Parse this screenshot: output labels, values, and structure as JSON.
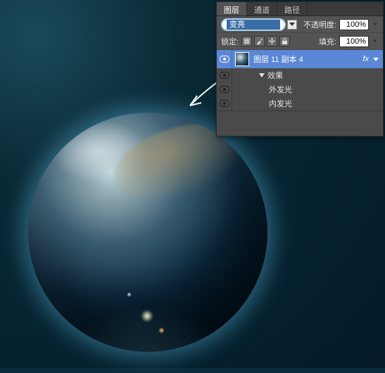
{
  "panel": {
    "tabs": {
      "layers": "图层",
      "channels": "通道",
      "paths": "路径"
    },
    "blend_mode": "变亮",
    "opacity_label": "不透明度:",
    "opacity_value": "100%",
    "lock_label": "锁定:",
    "fill_label": "填充:",
    "fill_value": "100%",
    "layer": {
      "name": "图层 11 副本 4",
      "fx_label": "fx",
      "effects_label": "效果",
      "outer_glow": "外发光",
      "inner_glow": "内发光"
    }
  }
}
